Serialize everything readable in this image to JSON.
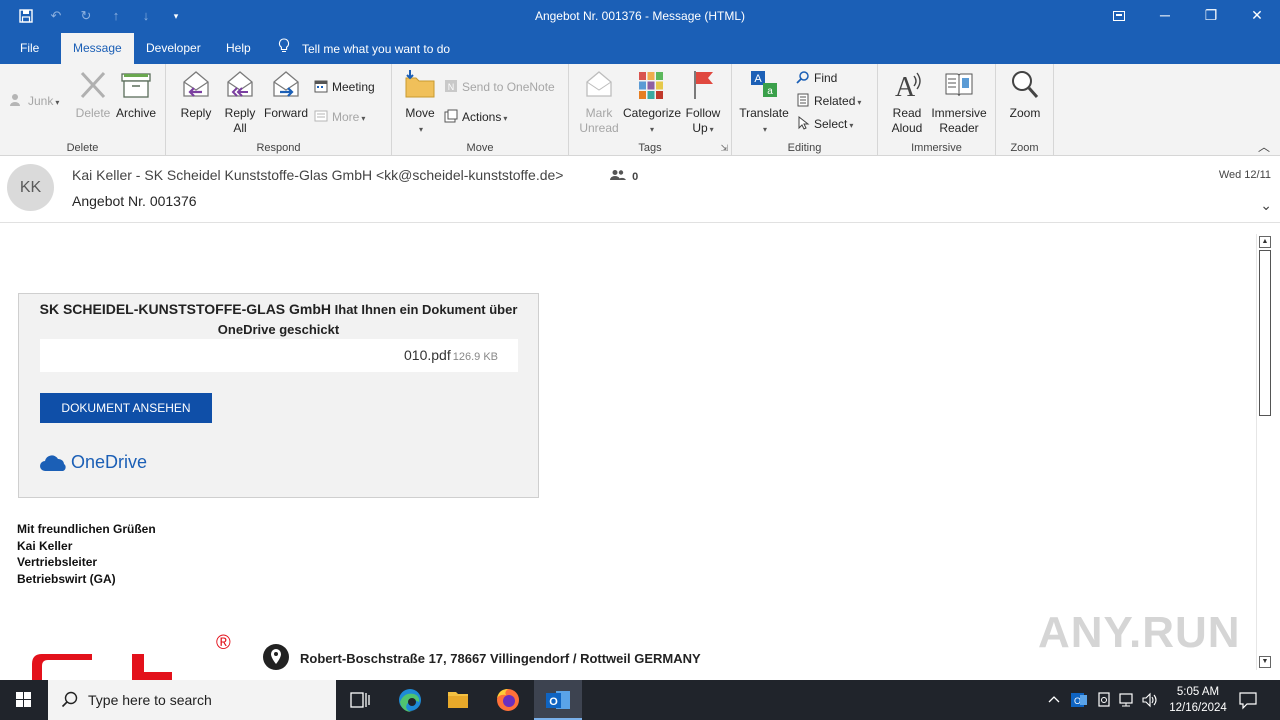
{
  "window": {
    "title": "Angebot Nr. 001376  -  Message (HTML)"
  },
  "tabs": {
    "file": "File",
    "message": "Message",
    "developer": "Developer",
    "help": "Help",
    "tell_me": "Tell me what you want to do"
  },
  "ribbon": {
    "delete_group": {
      "label": "Delete",
      "junk": "Junk",
      "delete": "Delete",
      "archive": "Archive"
    },
    "respond_group": {
      "label": "Respond",
      "reply": "Reply",
      "reply_all_1": "Reply",
      "reply_all_2": "All",
      "forward": "Forward",
      "meeting": "Meeting",
      "more": "More"
    },
    "move_group": {
      "label": "Move",
      "move": "Move",
      "send_to_onenote": "Send to OneNote",
      "actions": "Actions"
    },
    "tags_group": {
      "label": "Tags",
      "mark_unread_1": "Mark",
      "mark_unread_2": "Unread",
      "categorize": "Categorize",
      "follow_up_1": "Follow",
      "follow_up_2": "Up"
    },
    "editing_group": {
      "label": "Editing",
      "translate": "Translate",
      "find": "Find",
      "related": "Related",
      "select": "Select"
    },
    "immersive_group": {
      "label": "Immersive",
      "read_aloud_1": "Read",
      "read_aloud_2": "Aloud",
      "immersive_reader_1": "Immersive",
      "immersive_reader_2": "Reader"
    },
    "zoom_group": {
      "label": "Zoom",
      "zoom": "Zoom"
    }
  },
  "message": {
    "avatar_initials": "KK",
    "sender": "Kai Keller - SK Scheidel Kunststoffe-Glas GmbH <kk@scheidel-kunststoffe.de>",
    "people_count": "0",
    "subject": "Angebot Nr. 001376",
    "date": "Wed 12/11"
  },
  "body": {
    "card_title_company": "SK SCHEIDEL-KUNSTSTOFFE-GLAS GmbH",
    "card_title_rest": " Ihat Ihnen ein Dokument über",
    "card_title_line2": "OneDrive geschickt",
    "file_name": "010.pdf",
    "file_size": "126.9 KB",
    "view_button": "DOKUMENT ANSEHEN",
    "onedrive_logo_text": "OneDrive",
    "signature": [
      "Mit freundlichen  Grüßen",
      "Kai Keller",
      "Vertriebsleiter",
      "Betriebswirt  (GA)"
    ],
    "address": "Robert-Boschstraße 17, 78667 Villingendorf / Rottweil GERMANY",
    "logo_mark": "®",
    "watermark": "ANY.RUN"
  },
  "taskbar": {
    "search_placeholder": "Type here to search",
    "time": "5:05 AM",
    "date": "12/16/2024"
  },
  "colors": {
    "accent": "#1b5fb6",
    "button_blue": "#0f4fa8",
    "taskbar": "#20242b",
    "logo_red": "#e3111b"
  }
}
